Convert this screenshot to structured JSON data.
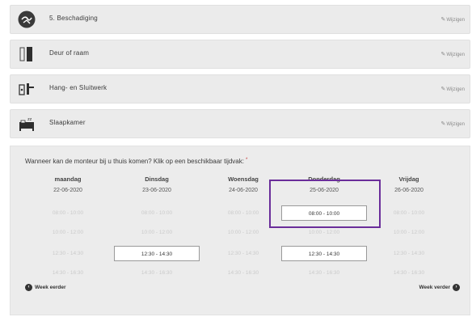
{
  "categories": [
    {
      "label": "5. Beschadiging",
      "icon": "damage-icon",
      "edit_label": "Wijzigen"
    },
    {
      "label": "Deur of raam",
      "icon": "door-window-icon",
      "edit_label": "Wijzigen"
    },
    {
      "label": "Hang- en Sluitwerk",
      "icon": "lock-hinge-icon",
      "edit_label": "Wijzigen"
    },
    {
      "label": "Slaapkamer",
      "icon": "bed-icon",
      "edit_label": "Wijzigen"
    }
  ],
  "schedule": {
    "question": "Wanneer kan de monteur bij u thuis komen? Klik op een beschikbaar tijdvak:",
    "required_mark": "*",
    "days": [
      {
        "day": "maandag",
        "date": "22-06-2020",
        "slots": [
          {
            "time": "08:00 - 10:00",
            "available": false
          },
          {
            "time": "10:00 - 12:00",
            "available": false
          },
          {
            "time": "12:30 - 14:30",
            "available": false
          },
          {
            "time": "14:30 - 16:30",
            "available": false
          }
        ]
      },
      {
        "day": "Dinsdag",
        "date": "23-06-2020",
        "slots": [
          {
            "time": "08:00 - 10:00",
            "available": false
          },
          {
            "time": "10:00 - 12:00",
            "available": false
          },
          {
            "time": "12:30 - 14:30",
            "available": true
          },
          {
            "time": "14:30 - 16:30",
            "available": false
          }
        ]
      },
      {
        "day": "Woensdag",
        "date": "24-06-2020",
        "slots": [
          {
            "time": "08:00 - 10:00",
            "available": false
          },
          {
            "time": "10:00 - 12:00",
            "available": false
          },
          {
            "time": "12:30 - 14:30",
            "available": false
          },
          {
            "time": "14:30 - 16:30",
            "available": false
          }
        ]
      },
      {
        "day": "Donderdag",
        "date": "25-06-2020",
        "slots": [
          {
            "time": "08:00 - 10:00",
            "available": true
          },
          {
            "time": "10:00 - 12:00",
            "available": false
          },
          {
            "time": "12:30 - 14:30",
            "available": true
          },
          {
            "time": "14:30 - 16:30",
            "available": false
          }
        ]
      },
      {
        "day": "Vrijdag",
        "date": "26-06-2020",
        "slots": [
          {
            "time": "08:00 - 10:00",
            "available": false
          },
          {
            "time": "10:00 - 12:00",
            "available": false
          },
          {
            "time": "12:30 - 14:30",
            "available": false
          },
          {
            "time": "14:30 - 16:30",
            "available": false
          }
        ]
      }
    ],
    "prev_label": "Week eerder",
    "next_label": "Week verder",
    "colors": {
      "highlight": "#6a2d9a",
      "unavailable_text": "#cacaca",
      "panel_bg": "#ececec"
    }
  }
}
